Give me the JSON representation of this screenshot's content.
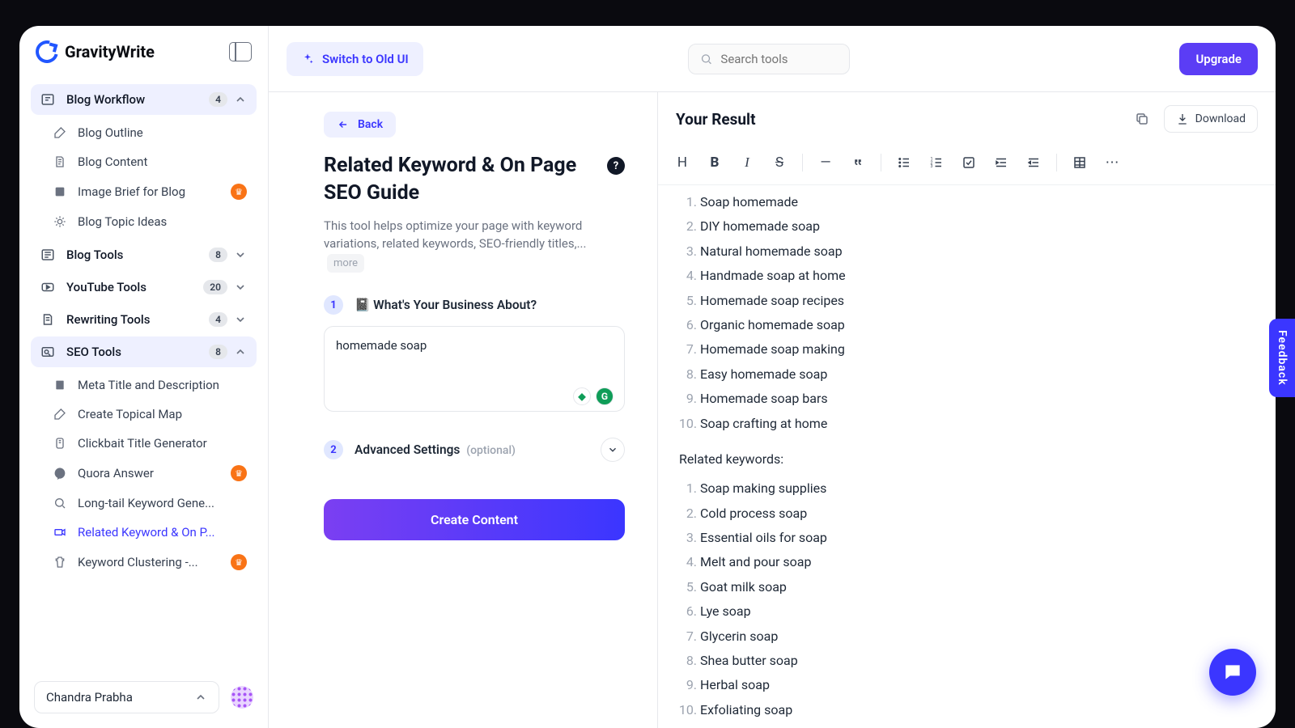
{
  "brand": "GravityWrite",
  "top": {
    "switch": "Switch to Old UI",
    "search_placeholder": "Search tools",
    "upgrade": "Upgrade"
  },
  "sidebar": {
    "cats": [
      {
        "label": "Blog Workflow",
        "badge": "4",
        "open": true
      },
      {
        "label": "Blog Tools",
        "badge": "8"
      },
      {
        "label": "YouTube Tools",
        "badge": "20"
      },
      {
        "label": "Rewriting Tools",
        "badge": "4"
      },
      {
        "label": "SEO Tools",
        "badge": "8",
        "open": true
      }
    ],
    "blog_sub": [
      {
        "label": "Blog Outline"
      },
      {
        "label": "Blog Content"
      },
      {
        "label": "Image Brief for Blog",
        "crown": true
      },
      {
        "label": "Blog Topic Ideas"
      }
    ],
    "seo_sub": [
      {
        "label": "Meta Title and Description"
      },
      {
        "label": "Create Topical Map"
      },
      {
        "label": "Clickbait Title Generator"
      },
      {
        "label": "Quora Answer",
        "crown": true
      },
      {
        "label": "Long-tail Keyword Gene..."
      },
      {
        "label": "Related Keyword & On P..."
      },
      {
        "label": "Keyword Clustering -...",
        "crown": true
      }
    ],
    "user": "Chandra Prabha"
  },
  "form": {
    "back": "Back",
    "title": "Related Keyword & On Page SEO Guide",
    "desc": "This tool helps optimize your page with keyword variations, related keywords, SEO-friendly titles,...",
    "more": "more",
    "step1": "📓 What's Your Business About?",
    "input": "homemade soap",
    "step2": "Advanced Settings",
    "optional": "(optional)",
    "create": "Create Content"
  },
  "result": {
    "heading": "Your Result",
    "download": "Download",
    "variations": [
      "Soap homemade",
      "DIY homemade soap",
      "Natural homemade soap",
      "Handmade soap at home",
      "Homemade soap recipes",
      "Organic homemade soap",
      "Homemade soap making",
      "Easy homemade soap",
      "Homemade soap bars",
      "Soap crafting at home"
    ],
    "related_h": "Related keywords:",
    "related": [
      "Soap making supplies",
      "Cold process soap",
      "Essential oils for soap",
      "Melt and pour soap",
      "Goat milk soap",
      "Lye soap",
      "Glycerin soap",
      "Shea butter soap",
      "Herbal soap",
      "Exfoliating soap"
    ]
  },
  "feedback": "Feedback"
}
